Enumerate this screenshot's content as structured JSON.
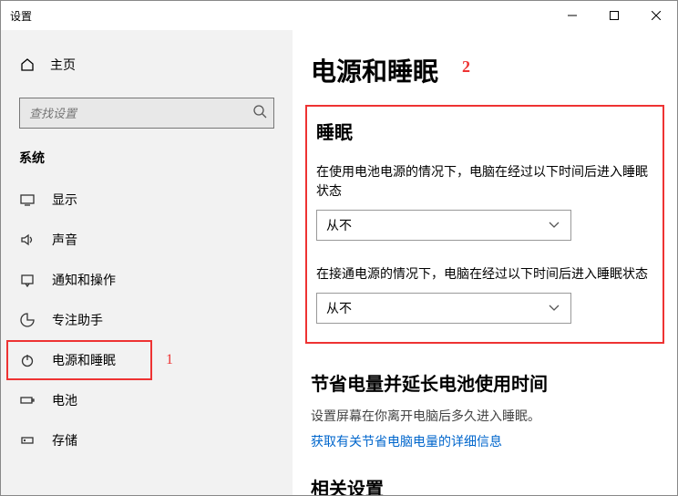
{
  "window": {
    "title": "设置"
  },
  "sidebar": {
    "home_label": "主页",
    "search_placeholder": "查找设置",
    "section_title": "系统",
    "items": [
      {
        "label": "显示"
      },
      {
        "label": "声音"
      },
      {
        "label": "通知和操作"
      },
      {
        "label": "专注助手"
      },
      {
        "label": "电源和睡眠"
      },
      {
        "label": "电池"
      },
      {
        "label": "存储"
      }
    ]
  },
  "annotations": {
    "one": "1",
    "two": "2"
  },
  "main": {
    "title": "电源和睡眠",
    "sleep": {
      "heading": "睡眠",
      "battery_label": "在使用电池电源的情况下，电脑在经过以下时间后进入睡眠状态",
      "battery_value": "从不",
      "plugged_label": "在接通电源的情况下，电脑在经过以下时间后进入睡眠状态",
      "plugged_value": "从不"
    },
    "power_save": {
      "heading": "节省电量并延长电池使用时间",
      "desc": "设置屏幕在你离开电脑后多久进入睡眠。",
      "link": "获取有关节省电脑电量的详细信息"
    },
    "related": {
      "heading": "相关设置"
    }
  }
}
